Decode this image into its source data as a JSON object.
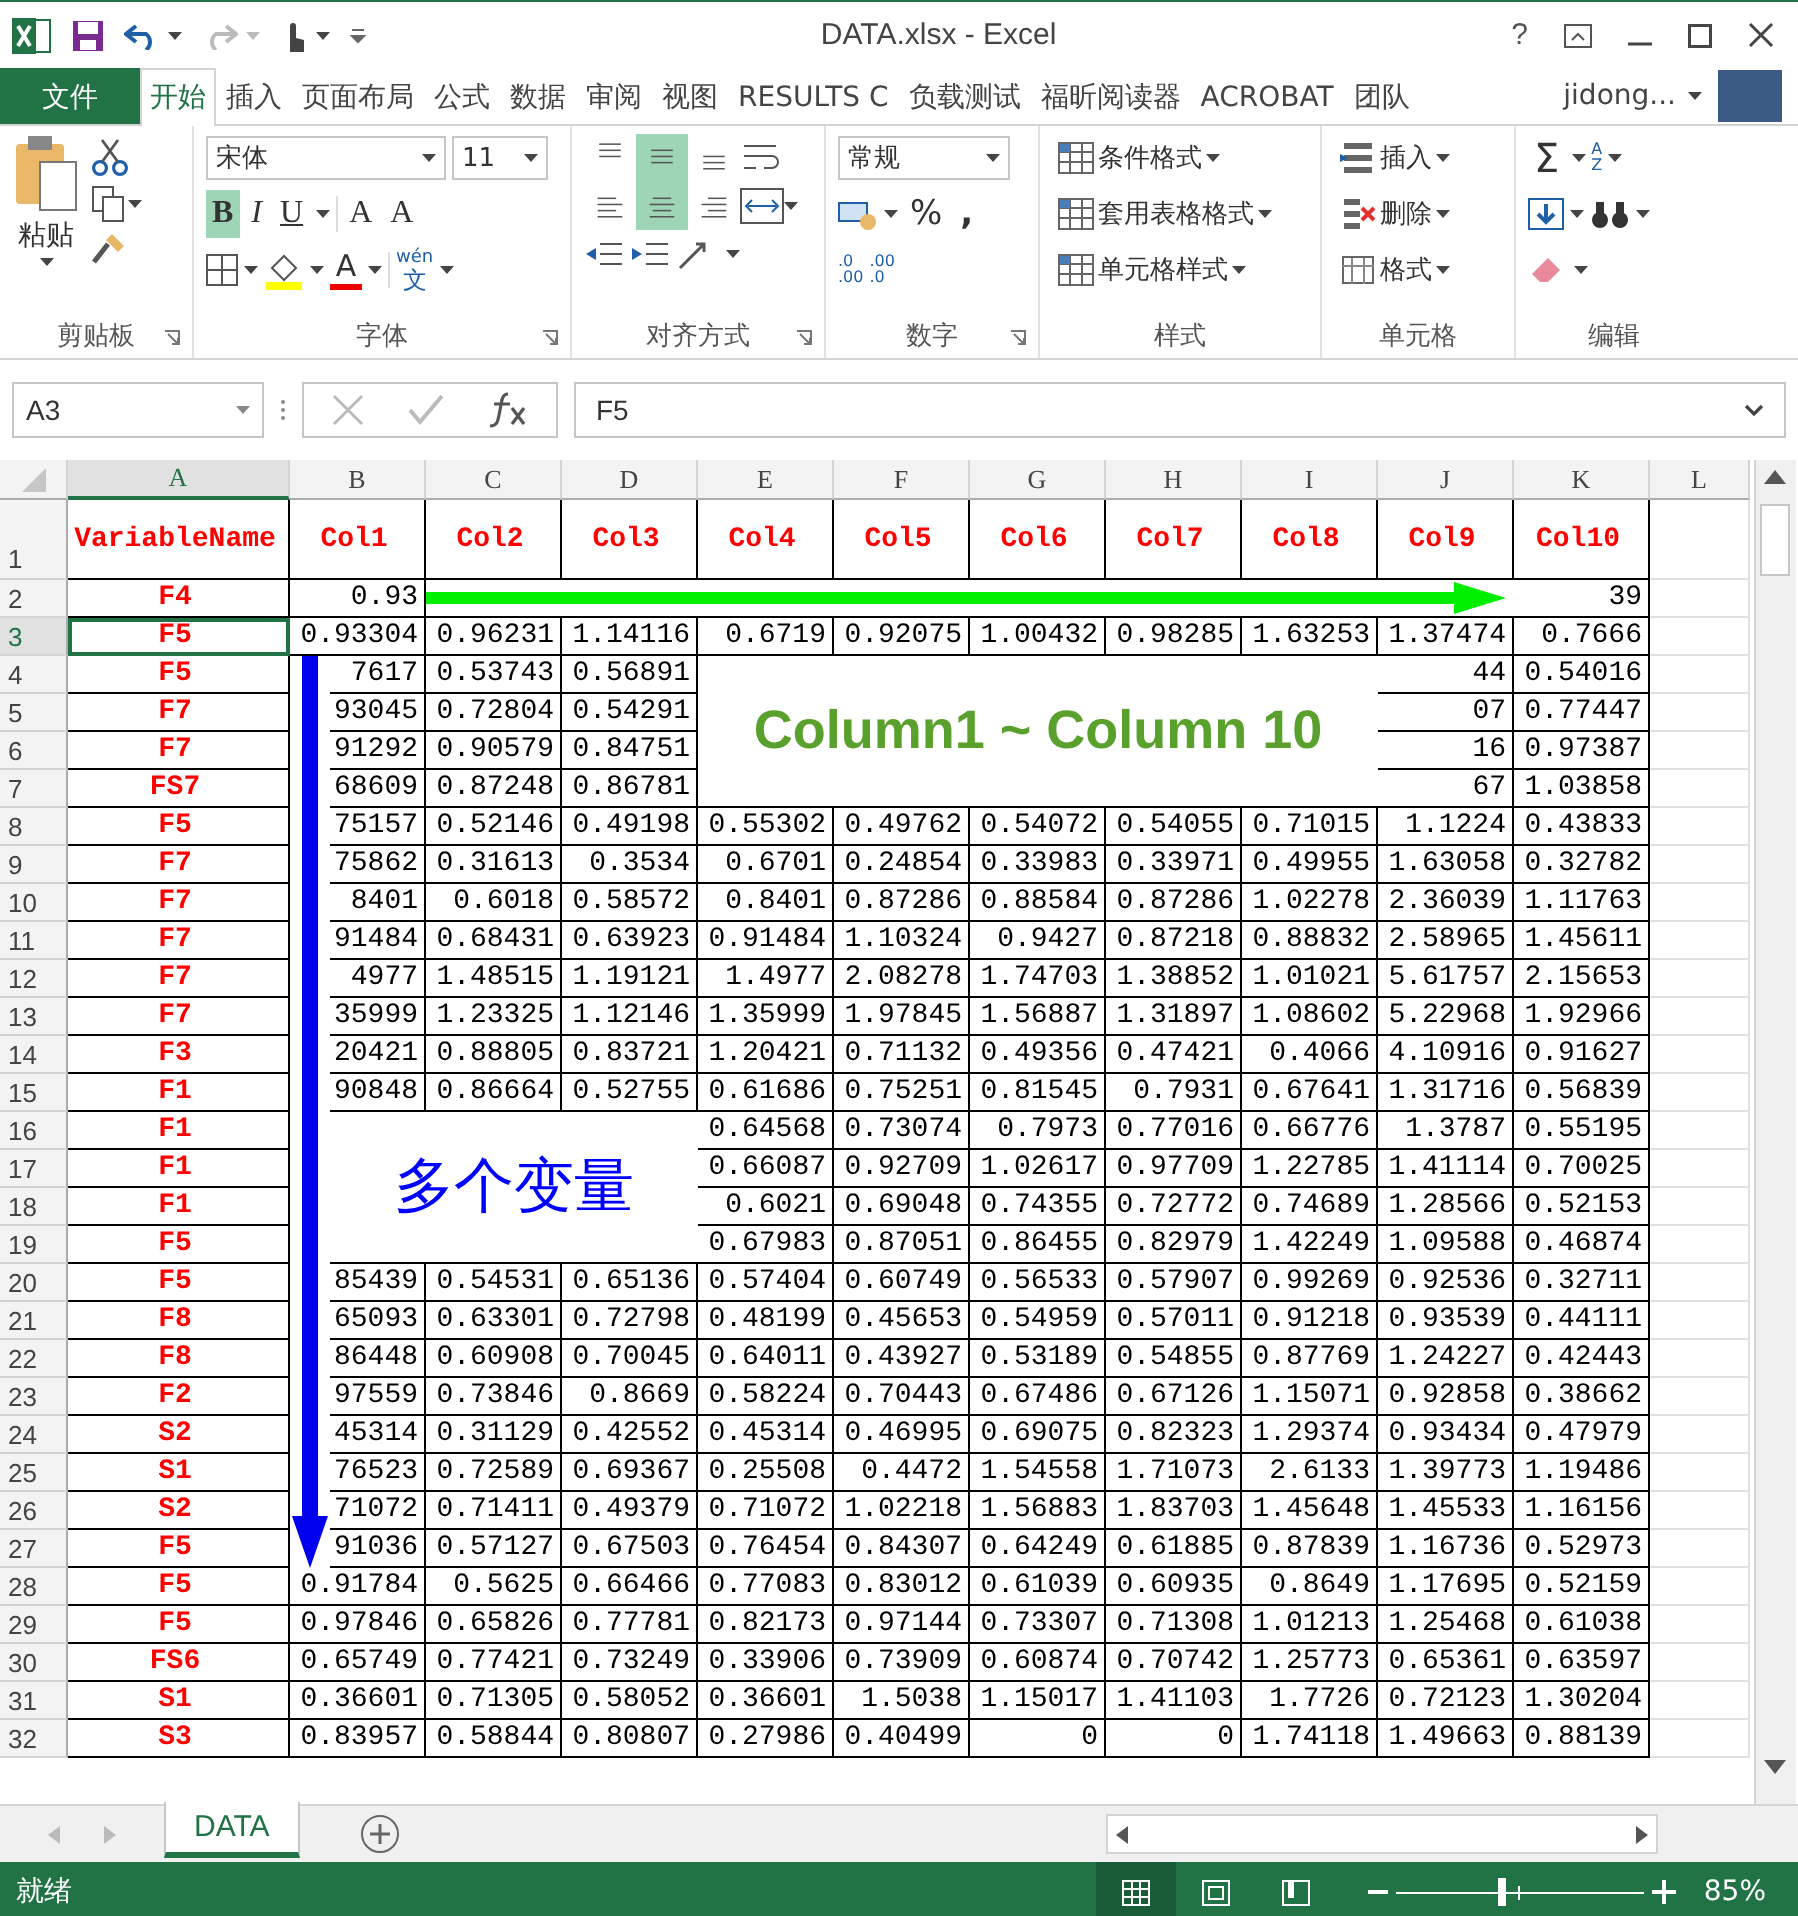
{
  "window": {
    "title": "DATA.xlsx - Excel",
    "help": "?"
  },
  "ribbon_tabs": [
    {
      "label": "文件",
      "kind": "file",
      "selected": false
    },
    {
      "label": "开始",
      "kind": "tab",
      "selected": true
    },
    {
      "label": "插入",
      "kind": "tab",
      "selected": false
    },
    {
      "label": "页面布局",
      "kind": "tab",
      "selected": false
    },
    {
      "label": "公式",
      "kind": "tab",
      "selected": false
    },
    {
      "label": "数据",
      "kind": "tab",
      "selected": false
    },
    {
      "label": "审阅",
      "kind": "tab",
      "selected": false
    },
    {
      "label": "视图",
      "kind": "tab",
      "selected": false
    },
    {
      "label": "RESULTS C",
      "kind": "tab",
      "selected": false
    },
    {
      "label": "负载测试",
      "kind": "tab",
      "selected": false
    },
    {
      "label": "福昕阅读器",
      "kind": "tab",
      "selected": false
    },
    {
      "label": "ACROBAT",
      "kind": "tab",
      "selected": false
    },
    {
      "label": "团队",
      "kind": "tab",
      "selected": false
    }
  ],
  "user": "jidong...",
  "clipboard": {
    "paste": "粘贴",
    "label": "剪贴板"
  },
  "font": {
    "name": "宋体",
    "size": "11",
    "label": "字体",
    "buttons": [
      {
        "label": "B",
        "kind": "bold",
        "on": true
      },
      {
        "label": "I",
        "kind": "italic",
        "on": false
      },
      {
        "label": "U",
        "kind": "underline",
        "on": false
      }
    ],
    "size_buttons": [
      "A",
      "A"
    ],
    "color_button": "A",
    "phonetic": {
      "top": "wén",
      "bottom": "文"
    }
  },
  "alignment": {
    "label": "对齐方式",
    "vertical_buttons": [
      {
        "kind": "top",
        "selected": false
      },
      {
        "kind": "middle",
        "selected": true
      },
      {
        "kind": "bottom",
        "selected": false
      }
    ],
    "horizontal_buttons": [
      {
        "kind": "left",
        "selected": false
      },
      {
        "kind": "center",
        "selected": true
      },
      {
        "kind": "right",
        "selected": false
      }
    ]
  },
  "number": {
    "format": "常规",
    "percent": "%",
    "comma": ",",
    "label": "数字",
    "decimal_buttons": [
      {
        "top": ".0",
        "bottom": ".00"
      },
      {
        "top": ".00",
        "bottom": ".0"
      }
    ]
  },
  "styles": {
    "label": "样式",
    "items": [
      "条件格式",
      "套用表格格式",
      "单元格样式"
    ]
  },
  "cells": {
    "label": "单元格",
    "items": [
      "插入",
      "删除",
      "格式"
    ]
  },
  "editing": {
    "label": "编辑",
    "sum": "Σ",
    "sort": [
      "A",
      "Z"
    ]
  },
  "formula_bar": {
    "name_box": "A3",
    "formula": "F5"
  },
  "sheet": {
    "columns": [
      {
        "letter": "A",
        "selected": true
      },
      {
        "letter": "B",
        "selected": false
      },
      {
        "letter": "C",
        "selected": false
      },
      {
        "letter": "D",
        "selected": false
      },
      {
        "letter": "E",
        "selected": false
      },
      {
        "letter": "F",
        "selected": false
      },
      {
        "letter": "G",
        "selected": false
      },
      {
        "letter": "H",
        "selected": false
      },
      {
        "letter": "I",
        "selected": false
      },
      {
        "letter": "J",
        "selected": false
      },
      {
        "letter": "K",
        "selected": false
      },
      {
        "letter": "L",
        "selected": false
      }
    ],
    "header_row": {
      "num": "1",
      "cells": [
        "VariableName",
        "Col1",
        "Col2",
        "Col3",
        "Col4",
        "Col5",
        "Col6",
        "Col7",
        "Col8",
        "Col9",
        "Col10"
      ]
    },
    "rows": [
      {
        "num": "2",
        "selected": false,
        "name": "F4",
        "cells": {
          "B": "0.93",
          "K": "39"
        }
      },
      {
        "num": "3",
        "selected": true,
        "name": "F5",
        "cells": {
          "B": "0.93304",
          "C": "0.96231",
          "D": "1.14116",
          "E": "0.6719",
          "F": "0.92075",
          "G": "1.00432",
          "H": "0.98285",
          "I": "1.63253",
          "J": "1.37474",
          "K": "0.7666"
        }
      },
      {
        "num": "4",
        "selected": false,
        "name": "F5",
        "cells": {
          "B": "7617",
          "C": "0.53743",
          "D": "0.56891",
          "J": "44",
          "K": "0.54016"
        }
      },
      {
        "num": "5",
        "selected": false,
        "name": "F7",
        "cells": {
          "B": "93045",
          "C": "0.72804",
          "D": "0.54291",
          "J": "07",
          "K": "0.77447"
        }
      },
      {
        "num": "6",
        "selected": false,
        "name": "F7",
        "cells": {
          "B": "91292",
          "C": "0.90579",
          "D": "0.84751",
          "J": "16",
          "K": "0.97387"
        }
      },
      {
        "num": "7",
        "selected": false,
        "name": "FS7",
        "cells": {
          "B": "68609",
          "C": "0.87248",
          "D": "0.86781",
          "J": "67",
          "K": "1.03858"
        }
      },
      {
        "num": "8",
        "selected": false,
        "name": "F5",
        "cells": {
          "B": "75157",
          "C": "0.52146",
          "D": "0.49198",
          "E": "0.55302",
          "F": "0.49762",
          "G": "0.54072",
          "H": "0.54055",
          "I": "0.71015",
          "J": "1.1224",
          "K": "0.43833"
        }
      },
      {
        "num": "9",
        "selected": false,
        "name": "F7",
        "cells": {
          "B": "75862",
          "C": "0.31613",
          "D": "0.3534",
          "E": "0.6701",
          "F": "0.24854",
          "G": "0.33983",
          "H": "0.33971",
          "I": "0.49955",
          "J": "1.63058",
          "K": "0.32782"
        }
      },
      {
        "num": "10",
        "selected": false,
        "name": "F7",
        "cells": {
          "B": "8401",
          "C": "0.6018",
          "D": "0.58572",
          "E": "0.8401",
          "F": "0.87286",
          "G": "0.88584",
          "H": "0.87286",
          "I": "1.02278",
          "J": "2.36039",
          "K": "1.11763"
        }
      },
      {
        "num": "11",
        "selected": false,
        "name": "F7",
        "cells": {
          "B": "91484",
          "C": "0.68431",
          "D": "0.63923",
          "E": "0.91484",
          "F": "1.10324",
          "G": "0.9427",
          "H": "0.87218",
          "I": "0.88832",
          "J": "2.58965",
          "K": "1.45611"
        }
      },
      {
        "num": "12",
        "selected": false,
        "name": "F7",
        "cells": {
          "B": "4977",
          "C": "1.48515",
          "D": "1.19121",
          "E": "1.4977",
          "F": "2.08278",
          "G": "1.74703",
          "H": "1.38852",
          "I": "1.01021",
          "J": "5.61757",
          "K": "2.15653"
        }
      },
      {
        "num": "13",
        "selected": false,
        "name": "F7",
        "cells": {
          "B": "35999",
          "C": "1.23325",
          "D": "1.12146",
          "E": "1.35999",
          "F": "1.97845",
          "G": "1.56887",
          "H": "1.31897",
          "I": "1.08602",
          "J": "5.22968",
          "K": "1.92966"
        }
      },
      {
        "num": "14",
        "selected": false,
        "name": "F3",
        "cells": {
          "B": "20421",
          "C": "0.88805",
          "D": "0.83721",
          "E": "1.20421",
          "F": "0.71132",
          "G": "0.49356",
          "H": "0.47421",
          "I": "0.4066",
          "J": "4.10916",
          "K": "0.91627"
        }
      },
      {
        "num": "15",
        "selected": false,
        "name": "F1",
        "cells": {
          "B": "90848",
          "C": "0.86664",
          "D": "0.52755",
          "E": "0.61686",
          "F": "0.75251",
          "G": "0.81545",
          "H": "0.7931",
          "I": "0.67641",
          "J": "1.31716",
          "K": "0.56839"
        }
      },
      {
        "num": "16",
        "selected": false,
        "name": "F1",
        "cells": {
          "E": "0.64568",
          "F": "0.73074",
          "G": "0.7973",
          "H": "0.77016",
          "I": "0.66776",
          "J": "1.3787",
          "K": "0.55195"
        }
      },
      {
        "num": "17",
        "selected": false,
        "name": "F1",
        "cells": {
          "E": "0.66087",
          "F": "0.92709",
          "G": "1.02617",
          "H": "0.97709",
          "I": "1.22785",
          "J": "1.41114",
          "K": "0.70025"
        }
      },
      {
        "num": "18",
        "selected": false,
        "name": "F1",
        "cells": {
          "E": "0.6021",
          "F": "0.69048",
          "G": "0.74355",
          "H": "0.72772",
          "I": "0.74689",
          "J": "1.28566",
          "K": "0.52153"
        }
      },
      {
        "num": "19",
        "selected": false,
        "name": "F5",
        "cells": {
          "E": "0.67983",
          "F": "0.87051",
          "G": "0.86455",
          "H": "0.82979",
          "I": "1.42249",
          "J": "1.09588",
          "K": "0.46874"
        }
      },
      {
        "num": "20",
        "selected": false,
        "name": "F5",
        "cells": {
          "B": "85439",
          "C": "0.54531",
          "D": "0.65136",
          "E": "0.57404",
          "F": "0.60749",
          "G": "0.56533",
          "H": "0.57907",
          "I": "0.99269",
          "J": "0.92536",
          "K": "0.32711"
        }
      },
      {
        "num": "21",
        "selected": false,
        "name": "F8",
        "cells": {
          "B": "65093",
          "C": "0.63301",
          "D": "0.72798",
          "E": "0.48199",
          "F": "0.45653",
          "G": "0.54959",
          "H": "0.57011",
          "I": "0.91218",
          "J": "0.93539",
          "K": "0.44111"
        }
      },
      {
        "num": "22",
        "selected": false,
        "name": "F8",
        "cells": {
          "B": "86448",
          "C": "0.60908",
          "D": "0.70045",
          "E": "0.64011",
          "F": "0.43927",
          "G": "0.53189",
          "H": "0.54855",
          "I": "0.87769",
          "J": "1.24227",
          "K": "0.42443"
        }
      },
      {
        "num": "23",
        "selected": false,
        "name": "F2",
        "cells": {
          "B": "97559",
          "C": "0.73846",
          "D": "0.8669",
          "E": "0.58224",
          "F": "0.70443",
          "G": "0.67486",
          "H": "0.67126",
          "I": "1.15071",
          "J": "0.92858",
          "K": "0.38662"
        }
      },
      {
        "num": "24",
        "selected": false,
        "name": "S2",
        "cells": {
          "B": "45314",
          "C": "0.31129",
          "D": "0.42552",
          "E": "0.45314",
          "F": "0.46995",
          "G": "0.69075",
          "H": "0.82323",
          "I": "1.29374",
          "J": "0.93434",
          "K": "0.47979"
        }
      },
      {
        "num": "25",
        "selected": false,
        "name": "S1",
        "cells": {
          "B": "76523",
          "C": "0.72589",
          "D": "0.69367",
          "E": "0.25508",
          "F": "0.4472",
          "G": "1.54558",
          "H": "1.71073",
          "I": "2.6133",
          "J": "1.39773",
          "K": "1.19486"
        }
      },
      {
        "num": "26",
        "selected": false,
        "name": "S2",
        "cells": {
          "B": "71072",
          "C": "0.71411",
          "D": "0.49379",
          "E": "0.71072",
          "F": "1.02218",
          "G": "1.56883",
          "H": "1.83703",
          "I": "1.45648",
          "J": "1.45533",
          "K": "1.16156"
        }
      },
      {
        "num": "27",
        "selected": false,
        "name": "F5",
        "cells": {
          "B": "91036",
          "C": "0.57127",
          "D": "0.67503",
          "E": "0.76454",
          "F": "0.84307",
          "G": "0.64249",
          "H": "0.61885",
          "I": "0.87839",
          "J": "1.16736",
          "K": "0.52973"
        }
      },
      {
        "num": "28",
        "selected": false,
        "name": "F5",
        "cells": {
          "B": "0.91784",
          "C": "0.5625",
          "D": "0.66466",
          "E": "0.77083",
          "F": "0.83012",
          "G": "0.61039",
          "H": "0.60935",
          "I": "0.8649",
          "J": "1.17695",
          "K": "0.52159"
        }
      },
      {
        "num": "29",
        "selected": false,
        "name": "F5",
        "cells": {
          "B": "0.97846",
          "C": "0.65826",
          "D": "0.77781",
          "E": "0.82173",
          "F": "0.97144",
          "G": "0.73307",
          "H": "0.71308",
          "I": "1.01213",
          "J": "1.25468",
          "K": "0.61038"
        }
      },
      {
        "num": "30",
        "selected": false,
        "name": "FS6",
        "cells": {
          "B": "0.65749",
          "C": "0.77421",
          "D": "0.73249",
          "E": "0.33906",
          "F": "0.73909",
          "G": "0.60874",
          "H": "0.70742",
          "I": "1.25773",
          "J": "0.65361",
          "K": "0.63597"
        }
      },
      {
        "num": "31",
        "selected": false,
        "name": "S1",
        "cells": {
          "B": "0.36601",
          "C": "0.71305",
          "D": "0.58052",
          "E": "0.36601",
          "F": "1.5038",
          "G": "1.15017",
          "H": "1.41103",
          "I": "1.7726",
          "J": "0.72123",
          "K": "1.30204"
        }
      },
      {
        "num": "32",
        "selected": false,
        "name": "S3",
        "cells": {
          "B": "0.83957",
          "C": "0.58844",
          "D": "0.80807",
          "E": "0.27986",
          "F": "0.40499",
          "G": "0",
          "H": "0",
          "I": "1.74118",
          "J": "1.49663",
          "K": "0.88139"
        }
      }
    ]
  },
  "callouts": [
    {
      "kind": "columns",
      "text": "Column1 ~ Column 10"
    },
    {
      "kind": "variables",
      "text": "多个变量"
    }
  ],
  "sheet_tabs": [
    {
      "label": "DATA",
      "selected": true
    }
  ],
  "status_bar": {
    "status": "就绪",
    "views": [
      {
        "kind": "normal",
        "selected": true
      },
      {
        "kind": "page_layout",
        "selected": false
      },
      {
        "kind": "page_break",
        "selected": false
      }
    ],
    "zoom_slider": {
      "level": 0.43
    },
    "zoom": "85%"
  }
}
